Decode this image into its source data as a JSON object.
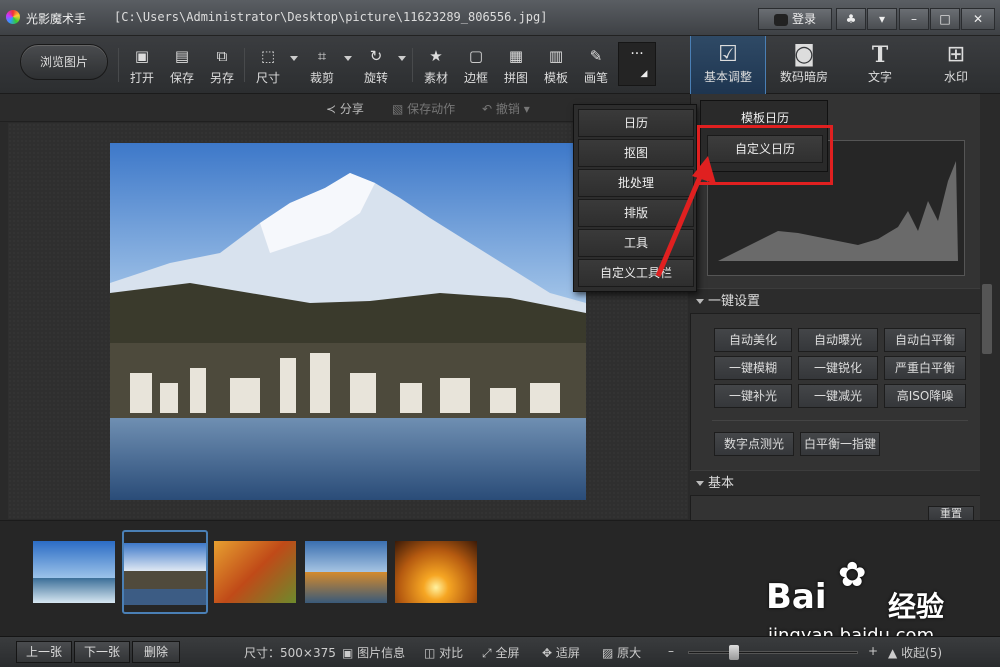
{
  "titlebar": {
    "app_name": "光影魔术手",
    "path": "[C:\\Users\\Administrator\\Desktop\\picture\\11623289_806556.jpg]",
    "login_label": "登录",
    "buttons": [
      "gift-icon",
      "menu-icon",
      "minimize-icon",
      "maximize-icon",
      "close-icon"
    ]
  },
  "toolbar": {
    "browse_label": "浏览图片",
    "tools": [
      {
        "label": "打开",
        "icon": "open-icon"
      },
      {
        "label": "保存",
        "icon": "save-icon"
      },
      {
        "label": "另存",
        "icon": "save-as-icon"
      },
      {
        "label": "尺寸",
        "icon": "resize-icon"
      },
      {
        "label": "裁剪",
        "icon": "crop-icon"
      },
      {
        "label": "旋转",
        "icon": "rotate-icon"
      },
      {
        "label": "素材",
        "icon": "material-icon"
      },
      {
        "label": "边框",
        "icon": "border-icon"
      },
      {
        "label": "拼图",
        "icon": "collage-icon"
      },
      {
        "label": "模板",
        "icon": "template-icon"
      },
      {
        "label": "画笔",
        "icon": "brush-icon"
      }
    ],
    "more_label": "···",
    "right_tabs": [
      {
        "label": "基本调整",
        "icon": "adjust-icon"
      },
      {
        "label": "数码暗房",
        "icon": "camera-icon"
      },
      {
        "label": "文字",
        "icon": "text-icon"
      },
      {
        "label": "水印",
        "icon": "watermark-icon"
      }
    ]
  },
  "subbar": {
    "share_label": "分享",
    "save_action_label": "保存动作",
    "undo_label": "撤销"
  },
  "dropdown": {
    "items": [
      "日历",
      "抠图",
      "批处理",
      "排版",
      "工具",
      "自定义工具栏"
    ]
  },
  "submenu": {
    "items": [
      "模板日历",
      "自定义日历"
    ]
  },
  "panel": {
    "one_click_title": "一键设置",
    "one_click_buttons": [
      "自动美化",
      "自动曝光",
      "自动白平衡",
      "一键模糊",
      "一键锐化",
      "严重白平衡",
      "一键补光",
      "一键减光",
      "高ISO降噪"
    ],
    "extra_buttons": [
      "数字点测光",
      "白平衡一指键"
    ],
    "basic_title": "基本",
    "reset_label": "重置"
  },
  "statusbar": {
    "prev_label": "上一张",
    "next_label": "下一张",
    "delete_label": "删除",
    "size_text": "尺寸：500×375",
    "info_label": "图片信息",
    "compare_label": "对比",
    "fullscreen_label": "全屏",
    "fit_label": "适屏",
    "original_label": "原大",
    "collapse_label": "收起(5)",
    "zoom_level": 0.5
  },
  "watermark": {
    "brand": "Bai",
    "brand_cn": "经验",
    "url": "jingyan.baidu.com"
  },
  "colors": {
    "accent_blue": "#2f4a66",
    "highlight_red": "#e02020"
  }
}
